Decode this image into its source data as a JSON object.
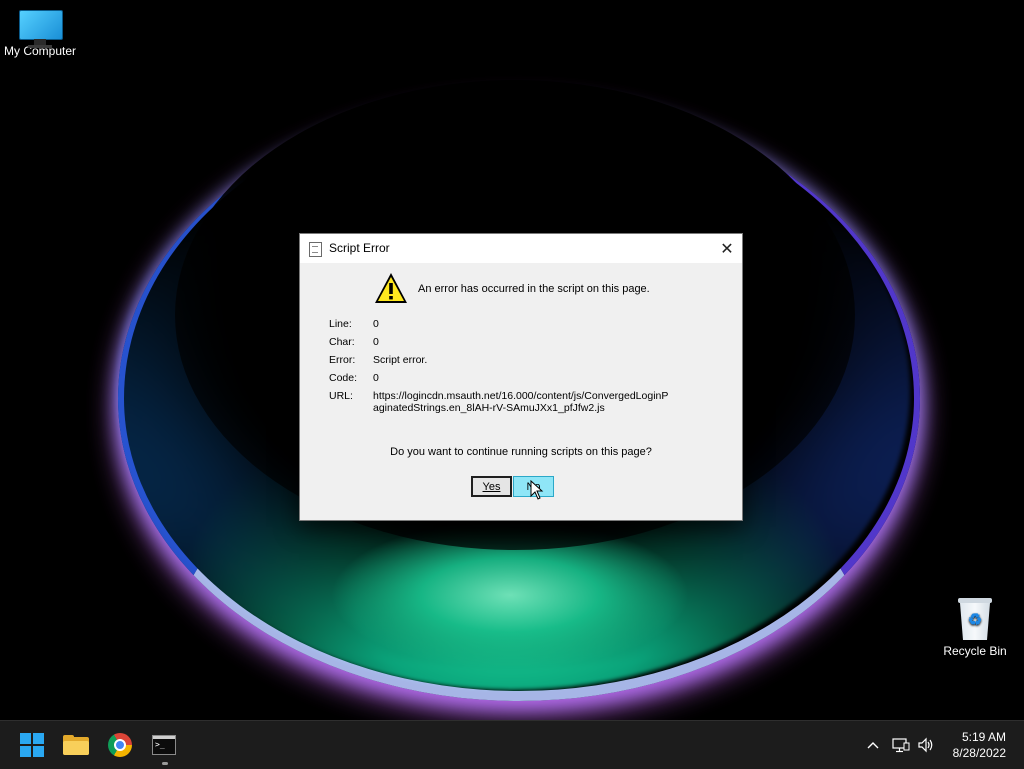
{
  "desktop": {
    "icons": [
      {
        "label": "My Computer",
        "icon": "monitor-icon"
      },
      {
        "label": "Recycle Bin",
        "icon": "recycle-bin-icon"
      }
    ]
  },
  "dialog": {
    "title": "Script Error",
    "close_glyph": "✕",
    "message": "An error has occurred in the script on this page.",
    "details": [
      {
        "key": "Line:",
        "value": "0"
      },
      {
        "key": "Char:",
        "value": "0"
      },
      {
        "key": "Error:",
        "value": "Script error."
      },
      {
        "key": "Code:",
        "value": "0"
      },
      {
        "key": "URL:",
        "value": "https://logincdn.msauth.net/16.000/content/js/ConvergedLoginPaginatedStrings.en_8lAH-rV-SAmuJXx1_pfJfw2.js"
      }
    ],
    "question": "Do you want to continue running scripts on this page?",
    "buttons": {
      "yes": "Yes",
      "no": "No"
    }
  },
  "taskbar": {
    "apps": [
      {
        "name": "Start",
        "icon": "windows-logo-icon"
      },
      {
        "name": "File Explorer",
        "icon": "folder-icon"
      },
      {
        "name": "Google Chrome",
        "icon": "chrome-icon"
      },
      {
        "name": "Command Prompt",
        "icon": "terminal-icon"
      }
    ],
    "tray_icons": [
      "chevron-up-icon",
      "network-icon",
      "volume-icon"
    ],
    "time": "5:19 AM",
    "date": "8/28/2022"
  },
  "colors": {
    "accent_start": "#2aa8f2",
    "no_button_highlight": "#8fe6f7",
    "taskbar": "#1c1c1c"
  }
}
